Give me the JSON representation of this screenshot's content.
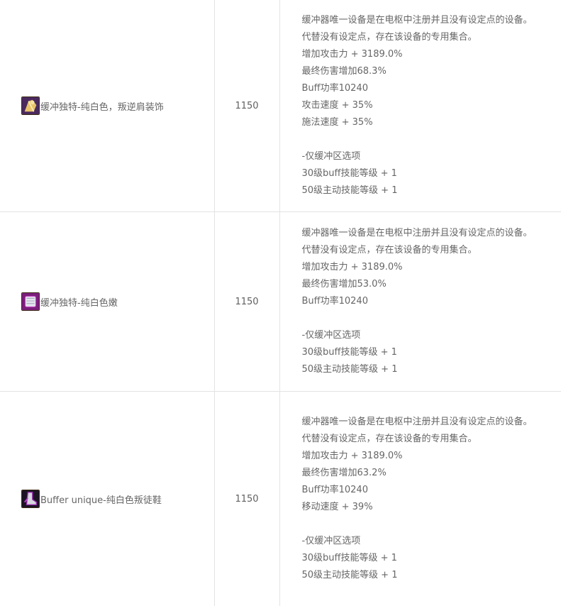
{
  "items": [
    {
      "name": "缓冲独特-纯白色，叛逆肩装饰",
      "icon": "shoulder-icon",
      "price": "1150",
      "lines": [
        "缓冲器唯一设备是在电枢中注册并且没有设定点的设备。",
        "代替没有设定点，存在该设备的专用集合。",
        "增加攻击力 + 3189.0%",
        "最终伤害增加68.3%",
        "Buff功率10240",
        "攻击速度 + 35%",
        "施法速度 + 35%",
        "",
        "-仅缓冲区选项",
        "30级buff技能等级 + 1",
        "50级主动技能等级 + 1"
      ]
    },
    {
      "name": "缓冲独特-纯白色嫩",
      "icon": "pants-icon",
      "price": "1150",
      "lines": [
        "缓冲器唯一设备是在电枢中注册并且没有设定点的设备。",
        "代替没有设定点，存在该设备的专用集合。",
        "增加攻击力 + 3189.0%",
        "最终伤害增加53.0%",
        "Buff功率10240",
        "",
        "-仅缓冲区选项",
        "30级buff技能等级 + 1",
        "50级主动技能等级 + 1"
      ]
    },
    {
      "name": "Buffer unique-纯白色叛徒鞋",
      "icon": "boots-icon",
      "price": "1150",
      "lines": [
        "缓冲器唯一设备是在电枢中注册并且没有设定点的设备。",
        "代替没有设定点，存在该设备的专用集合。",
        "增加攻击力 + 3189.0%",
        "最终伤害增加63.2%",
        "Buff功率10240",
        "移动速度 + 39%",
        "",
        "-仅缓冲区选项",
        "30级buff技能等级 + 1",
        "50级主动技能等级 + 1"
      ]
    }
  ]
}
